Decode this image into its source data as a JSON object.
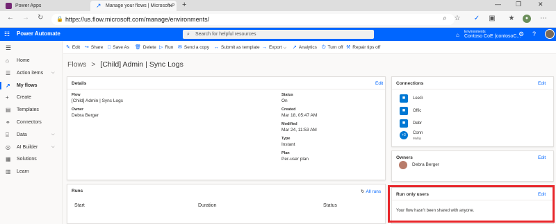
{
  "browser": {
    "tabs": [
      {
        "label": "Power Apps",
        "fav_color": "#742774"
      },
      {
        "label": "Manage your flows | Microsoft P",
        "fav_color": "#0066ff"
      }
    ],
    "url": "https://us.flow.microsoft.com/manage/environments/"
  },
  "header": {
    "app_name": "Power Automate",
    "search_placeholder": "Search for helpful resources",
    "env_label": "Environments",
    "env_name": "Contoso CoE (contosoC..."
  },
  "nav": {
    "items": [
      {
        "label": "Home",
        "icon": "home-icon"
      },
      {
        "label": "Action items",
        "icon": "checklist-icon",
        "chevron": true
      },
      {
        "label": "My flows",
        "icon": "flow-icon",
        "active": true
      },
      {
        "label": "Create",
        "icon": "plus-icon"
      },
      {
        "label": "Templates",
        "icon": "template-icon"
      },
      {
        "label": "Connectors",
        "icon": "connector-icon"
      },
      {
        "label": "Data",
        "icon": "database-icon",
        "chevron": true
      },
      {
        "label": "AI Builder",
        "icon": "ai-icon",
        "chevron": true
      },
      {
        "label": "Solutions",
        "icon": "solutions-icon"
      },
      {
        "label": "Learn",
        "icon": "book-icon"
      }
    ]
  },
  "commands": {
    "edit": "Edit",
    "share": "Share",
    "save_as": "Save As",
    "delete": "Delete",
    "run": "Run",
    "send_copy": "Send a copy",
    "submit_template": "Submit as template",
    "export": "Export",
    "analytics": "Analytics",
    "turn_off": "Turn off",
    "repair_tips": "Repair tips off"
  },
  "breadcrumb": {
    "parent": "Flows",
    "sep": ">",
    "current": "[Child] Admin | Sync Logs"
  },
  "details": {
    "title": "Details",
    "edit": "Edit",
    "flow_label": "Flow",
    "flow_value": "[Child] Admin | Sync Logs",
    "owner_label": "Owner",
    "owner_value": "Debra Berger",
    "status_label": "Status",
    "status_value": "On",
    "created_label": "Created",
    "created_value": "Mar 18, 05:47 AM",
    "modified_label": "Modified",
    "modified_value": "Mar 24, 11:53 AM",
    "type_label": "Type",
    "type_value": "Instant",
    "plan_label": "Plan",
    "plan_value": "Per-user plan"
  },
  "runs": {
    "title": "Runs",
    "all_runs": "All runs",
    "columns": [
      "Start",
      "Duration",
      "Status"
    ]
  },
  "connections": {
    "title": "Connections",
    "edit": "Edit",
    "items": [
      {
        "name": "LeeG",
        "sub": ""
      },
      {
        "name": "Offic",
        "sub": ""
      },
      {
        "name": "Debr",
        "sub": ""
      }
    ],
    "more_label": "+3",
    "more_name": "Conn",
    "more_sub": "Multip"
  },
  "owners": {
    "title": "Owners",
    "edit": "Edit",
    "name": "Debra Berger"
  },
  "run_only": {
    "title": "Run only users",
    "edit": "Edit",
    "message": "Your flow hasn't been shared with anyone."
  }
}
